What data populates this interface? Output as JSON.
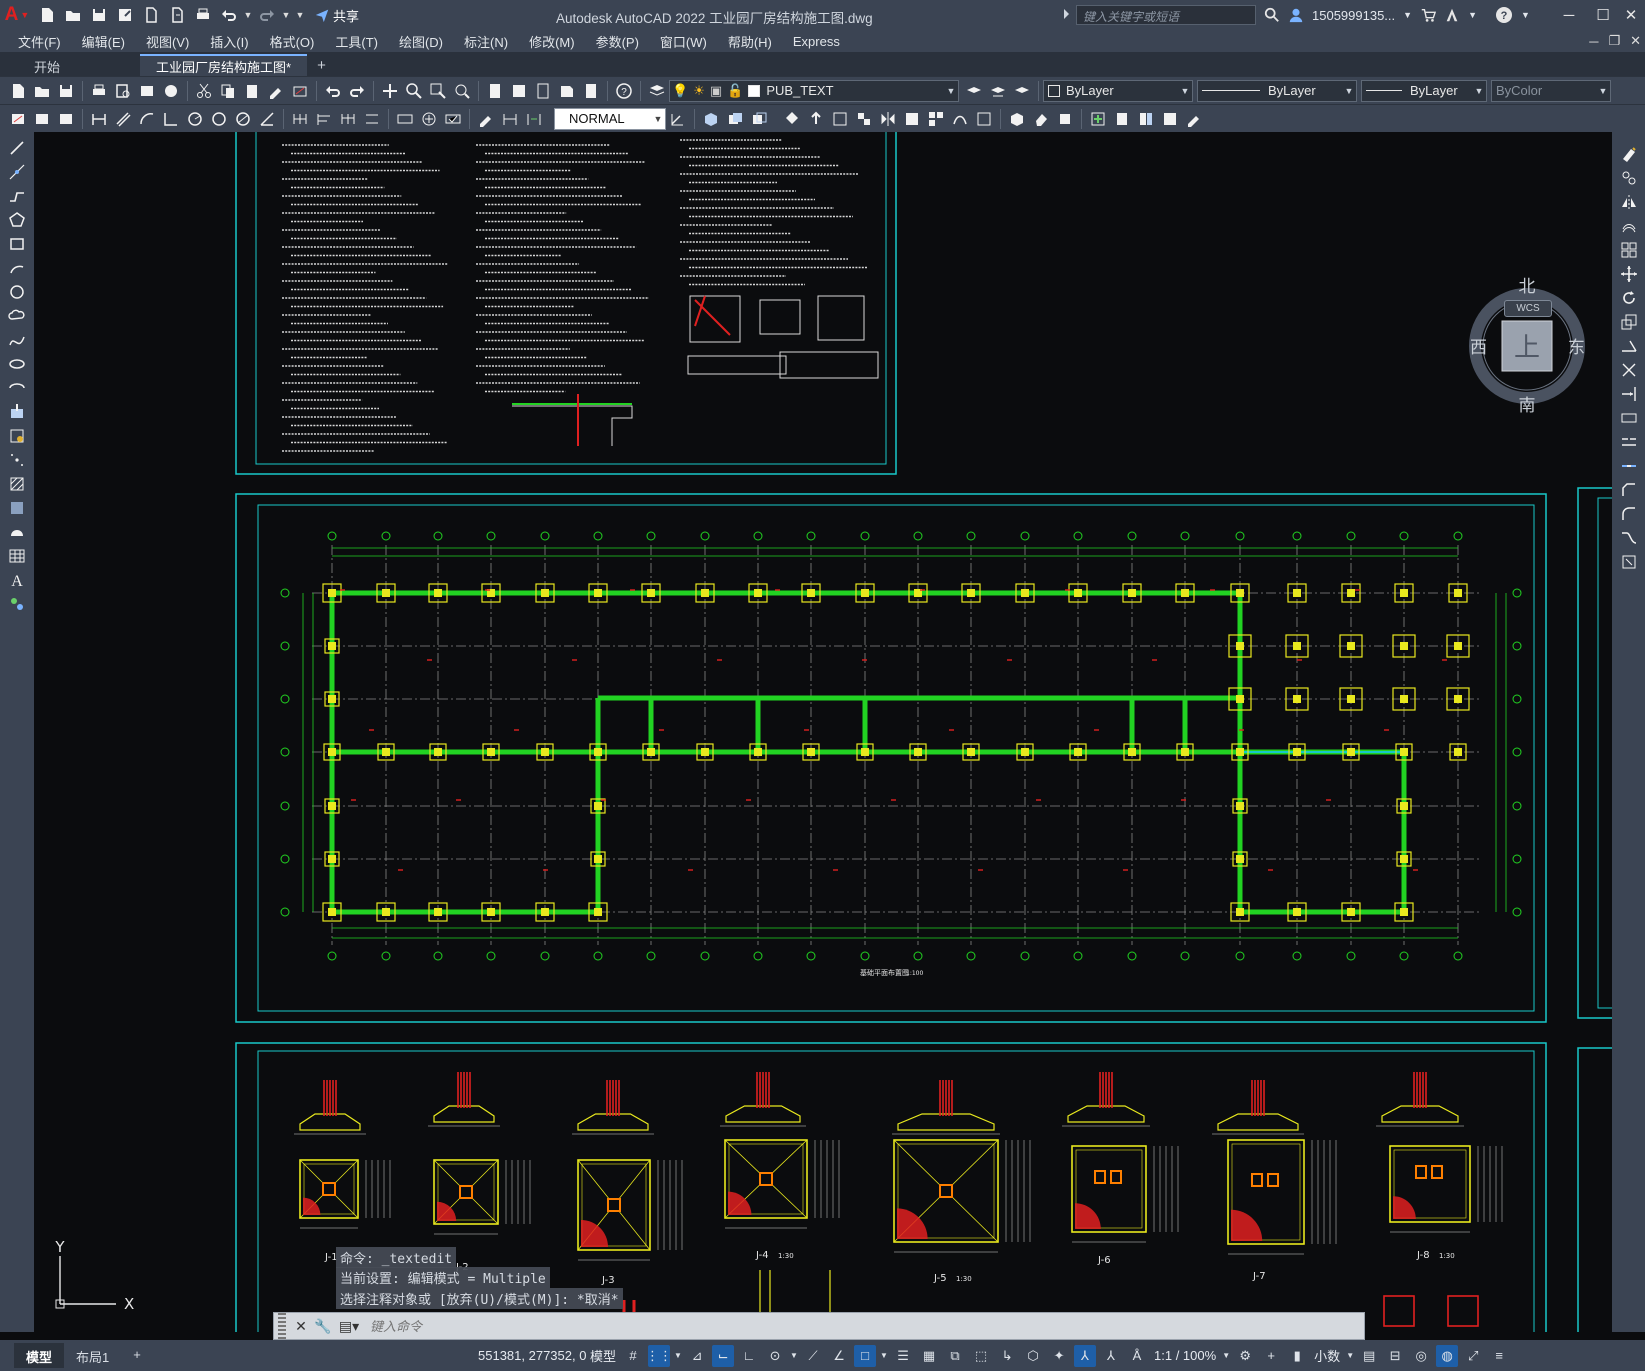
{
  "app": {
    "title": "Autodesk AutoCAD 2022    工业园厂房结构施工图.dwg",
    "logo": "A",
    "share_label": "共享",
    "search_placeholder": "键入关键字或短语",
    "user": "1505999135...",
    "minimize": "─",
    "restore": "☐",
    "close": "✕"
  },
  "menu": [
    "文件(F)",
    "编辑(E)",
    "视图(V)",
    "插入(I)",
    "格式(O)",
    "工具(T)",
    "绘图(D)",
    "标注(N)",
    "修改(M)",
    "参数(P)",
    "窗口(W)",
    "帮助(H)",
    "Express"
  ],
  "tabs": {
    "start": "开始",
    "active": "工业园厂房结构施工图*",
    "plus": "+"
  },
  "layer_toolbar": {
    "layer": "PUB_TEXT",
    "color": "ByLayer",
    "linetype": "ByLayer",
    "lineweight": "ByLayer",
    "plotstyle": "ByColor"
  },
  "dim_toolbar": {
    "dimstyle": "NORMAL"
  },
  "viewcube": {
    "north": "北",
    "south": "南",
    "east": "东",
    "west": "西",
    "top": "上",
    "wcs": "WCS"
  },
  "ucs": {
    "y": "Y",
    "x": "X"
  },
  "drawing": {
    "plan_title": "基础平面布置图",
    "plan_scale": "1:100",
    "footings": [
      "J-1",
      "J-2",
      "J-3",
      "J-4",
      "J-5",
      "J-6",
      "J-7",
      "J-8"
    ],
    "footing_scale": "1:30"
  },
  "command": {
    "history": [
      "命令: _textedit",
      "当前设置: 编辑模式 = Multiple",
      "选择注释对象或 [放弃(U)/模式(M)]: *取消*"
    ],
    "placeholder": "键入命令"
  },
  "status": {
    "model_tab": "模型",
    "layout_tab": "布局1",
    "plus": "+",
    "coords": "551381, 277352, 0",
    "model_space": "模型",
    "scale": "1:1 / 100%",
    "units": "小数"
  }
}
